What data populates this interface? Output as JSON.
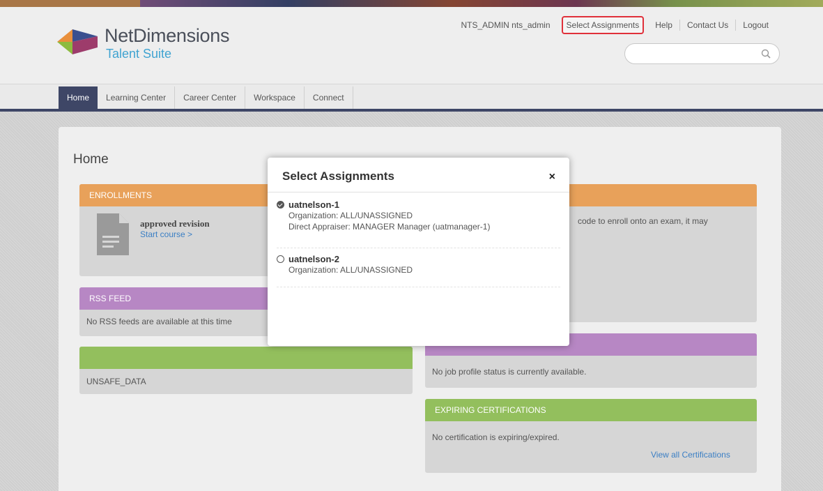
{
  "brand": {
    "name": "NetDimensions",
    "product": "Talent Suite",
    "colors": {
      "nav": "#3e4666",
      "accent_link": "#3b7fc4",
      "orange": "#e8a15a",
      "purple": "#b787c4",
      "green": "#93bf5d",
      "highlight": "#e0303a"
    }
  },
  "toplinks": {
    "user": "NTS_ADMIN nts_admin",
    "select_assignments": "Select Assignments",
    "help": "Help",
    "contact": "Contact Us",
    "logout": "Logout"
  },
  "search": {
    "placeholder": "",
    "icon": "search-icon"
  },
  "nav": {
    "tabs": [
      {
        "label": "Home",
        "active": true
      },
      {
        "label": "Learning Center"
      },
      {
        "label": "Career Center"
      },
      {
        "label": "Workspace"
      },
      {
        "label": "Connect"
      }
    ]
  },
  "page": {
    "title": "Home"
  },
  "widgets": {
    "enrollments": {
      "title": "ENROLLMENTS",
      "course_name": "approved revision",
      "course_link": "Start course >"
    },
    "right_top": {
      "partial_text": "code to enroll onto an exam, it may"
    },
    "rss": {
      "title": "RSS FEED",
      "body": "No RSS feeds are available at this time"
    },
    "unsafe": {
      "title": "",
      "body": "UNSAFE_DATA"
    },
    "job_profile": {
      "body": "No job profile status is currently available."
    },
    "certifications": {
      "title": "EXPIRING CERTIFICATIONS",
      "body": "No certification is expiring/expired.",
      "link": "View all Certifications"
    }
  },
  "modal": {
    "title": "Select Assignments",
    "close": "×",
    "options": [
      {
        "name": "uatnelson-1",
        "selected": true,
        "org": "Organization: ALL/UNASSIGNED",
        "appraiser": "Direct Appraiser: MANAGER Manager (uatmanager-1)"
      },
      {
        "name": "uatnelson-2",
        "selected": false,
        "org": "Organization: ALL/UNASSIGNED"
      }
    ]
  }
}
